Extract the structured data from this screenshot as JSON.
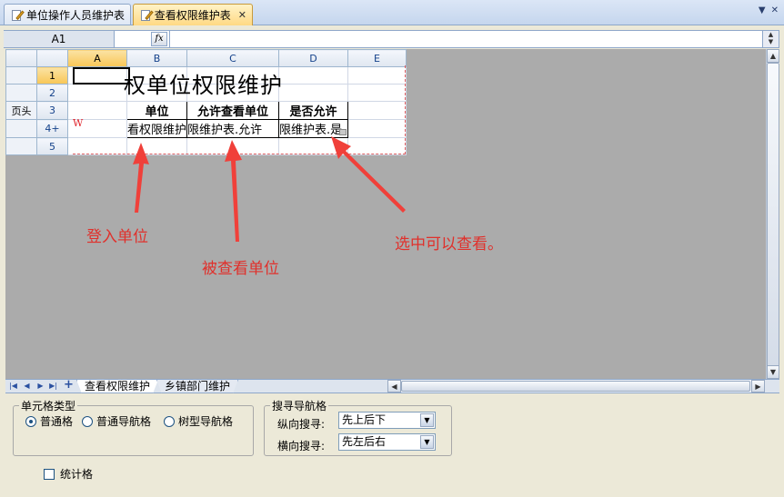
{
  "tabs": [
    {
      "label": "单位操作人员维护表",
      "active": false
    },
    {
      "label": "查看权限维护表",
      "active": true
    }
  ],
  "window_ctrls": {
    "dropdown": "▼",
    "close": "✕"
  },
  "formula_bar": {
    "cell_ref": "A1",
    "fx": "fx",
    "value": ""
  },
  "sheet": {
    "columns": [
      "A",
      "B",
      "C",
      "D",
      "E"
    ],
    "rows": [
      "1",
      "2",
      "3",
      "4+",
      "5"
    ],
    "row_prefix": {
      "r3": "页头"
    },
    "title": "权单位权限维护",
    "header_cells": [
      "单位",
      "允许查看单位",
      "是否允许"
    ],
    "data_cells": [
      "看权限维护",
      "限维护表.允许",
      "限维护表.是"
    ],
    "w_mark": "W"
  },
  "annotations": [
    {
      "text": "登入单位"
    },
    {
      "text": "被查看单位"
    },
    {
      "text": "选中可以查看。"
    }
  ],
  "sheet_tabs": [
    "查看权限维护",
    "乡镇部门维护"
  ],
  "cell_type": {
    "legend": "单元格类型",
    "options": [
      "普通格",
      "普通导航格",
      "树型导航格"
    ],
    "selected": "普通格"
  },
  "search_nav": {
    "legend": "搜寻导航格",
    "vertical_label": "纵向搜寻:",
    "vertical_value": "先上后下",
    "horizontal_label": "横向搜寻:",
    "horizontal_value": "先左后右"
  },
  "stat_cell": {
    "label": "统计格",
    "checked": false
  }
}
